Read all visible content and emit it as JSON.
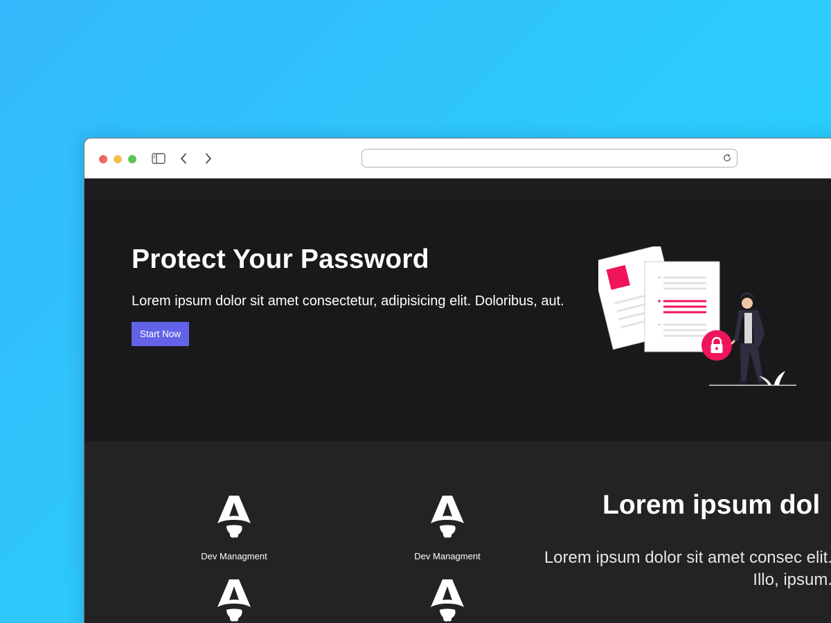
{
  "browser": {
    "url": "",
    "icons": [
      "close-dot",
      "minimize-dot",
      "zoom-dot",
      "sidebar-icon",
      "back-icon",
      "forward-icon",
      "reload-icon"
    ]
  },
  "hero": {
    "title": "Protect Your Password",
    "subtitle": "Lorem ipsum dolor sit amet consectetur, adipisicing elit. Doloribus, aut.",
    "cta_label": "Start Now"
  },
  "features": {
    "items": [
      {
        "label": "Dev Managment",
        "icon": "astro-logo-icon"
      },
      {
        "label": "Dev Managment",
        "icon": "astro-logo-icon"
      },
      {
        "label": "",
        "icon": "astro-logo-icon"
      },
      {
        "label": "",
        "icon": "astro-logo-icon"
      }
    ],
    "title": "Lorem ipsum dol",
    "text": "Lorem ipsum dolor sit amet consec elit. Illo, ipsum."
  },
  "colors": {
    "accent": "#6363e8",
    "illustration_accent": "#f0145a",
    "background_gradient": [
      "#35b8fb",
      "#24d2ff"
    ],
    "page_dark": "#19191b"
  }
}
